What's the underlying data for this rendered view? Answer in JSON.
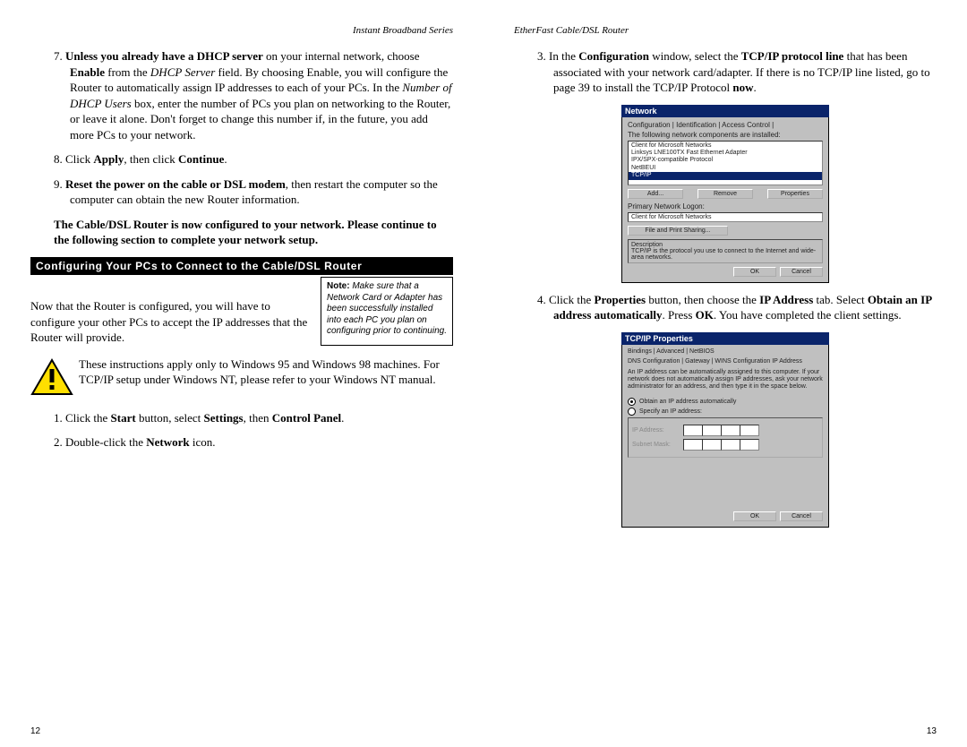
{
  "leftHeader": "Instant Broadband Series",
  "rightHeader": "EtherFast Cable/DSL Router",
  "step7_prefix": "7. ",
  "step7_b1": "Unless you already have a DHCP server",
  "step7_m1": " on your internal network, choose ",
  "step7_b2": "Enable",
  "step7_m2": " from the ",
  "step7_i1": "DHCP Server",
  "step7_m3": " field. By choosing Enable, you will configure the Router to automatically assign IP addresses to each of your PCs. In the ",
  "step7_i2": "Number of DHCP Users",
  "step7_m4": " box, enter the number of PCs you plan on networking to the Router, or leave it alone. Don't forget to change this number if, in the future, you add more PCs to your network.",
  "step8_prefix": "8. Click ",
  "step8_b1": "Apply",
  "step8_m1": ", then click ",
  "step8_b2": "Continue",
  "step8_end": ".",
  "step9_prefix": "9. ",
  "step9_b1": "Reset the power on the cable or DSL modem",
  "step9_m1": ", then restart the computer so the computer can obtain the new Router information.",
  "closing": "The Cable/DSL Router is now configured to your network. Please continue to the following section to complete your network setup.",
  "secTitle": "Configuring Your PCs to Connect to the Cable/DSL Router",
  "noteBold": "Note:",
  "noteText": " Make sure that a Network Card or Adapter has been successfully installed into each PC you plan on configuring prior to continuing.",
  "noteLeft": "Now that the Router is configured, you will have to configure your other PCs to accept the IP addresses that the Router will provide.",
  "warnText": "These instructions apply only to Windows 95 and Windows 98 machines. For TCP/IP setup under Windows NT, please refer to your Windows NT manual.",
  "l1_prefix": "1. Click the ",
  "l1_b1": "Start",
  "l1_m1": " button, select ",
  "l1_b2": "Settings",
  "l1_m2": ", then ",
  "l1_b3": "Control Panel",
  "l1_end": ".",
  "l2_prefix": "2. Double-click the ",
  "l2_b1": "Network",
  "l2_end": " icon.",
  "r3_prefix": "3. In the ",
  "r3_b1": "Configuration",
  "r3_m1": " window, select the ",
  "r3_b2": "TCP/IP protocol line",
  "r3_m2": " that has been associated with your network card/adapter. If there is no TCP/IP line listed, go to page 39 to install the TCP/IP Protocol ",
  "r3_b3": "now",
  "r3_end": ".",
  "r4_prefix": "4. Click the ",
  "r4_b1": "Properties",
  "r4_m1": " button, then choose the ",
  "r4_b2": "IP Address",
  "r4_m2": " tab. Select ",
  "r4_b3": "Obtain an IP address automatically",
  "r4_m3": ". Press ",
  "r4_b4": "OK",
  "r4_m4": ". You have completed the client settings.",
  "pageLeftNum": "12",
  "pageRightNum": "13",
  "dlg1": {
    "title": "Network",
    "tabs": "Configuration | Identification | Access Control |",
    "listLabel": "The following network components are installed:",
    "items": [
      "Client for Microsoft Networks",
      "Linksys LNE100TX Fast Ethernet Adapter",
      "IPX/SPX-compatible Protocol",
      "NetBEUI",
      "TCP/IP"
    ],
    "selectedIndex": 4,
    "btnAdd": "Add...",
    "btnRemove": "Remove",
    "btnProps": "Properties",
    "primaryLabel": "Primary Network Logon:",
    "primaryValue": "Client for Microsoft Networks",
    "fileShare": "File and Print Sharing...",
    "descLabel": "Description",
    "descText": "TCP/IP is the protocol you use to connect to the Internet and wide-area networks.",
    "ok": "OK",
    "cancel": "Cancel"
  },
  "dlg2": {
    "title": "TCP/IP Properties",
    "tabs1": "Bindings          |          Advanced          |          NetBIOS",
    "tabs2": "DNS Configuration | Gateway | WINS Configuration   IP Address",
    "desc": "An IP address can be automatically assigned to this computer. If your network does not automatically assign IP addresses, ask your network administrator for an address, and then type it in the space below.",
    "opt1": "Obtain an IP address automatically",
    "opt2": "Specify an IP address:",
    "ipLabel": "IP Address:",
    "maskLabel": "Subnet Mask:",
    "ok": "OK",
    "cancel": "Cancel"
  }
}
